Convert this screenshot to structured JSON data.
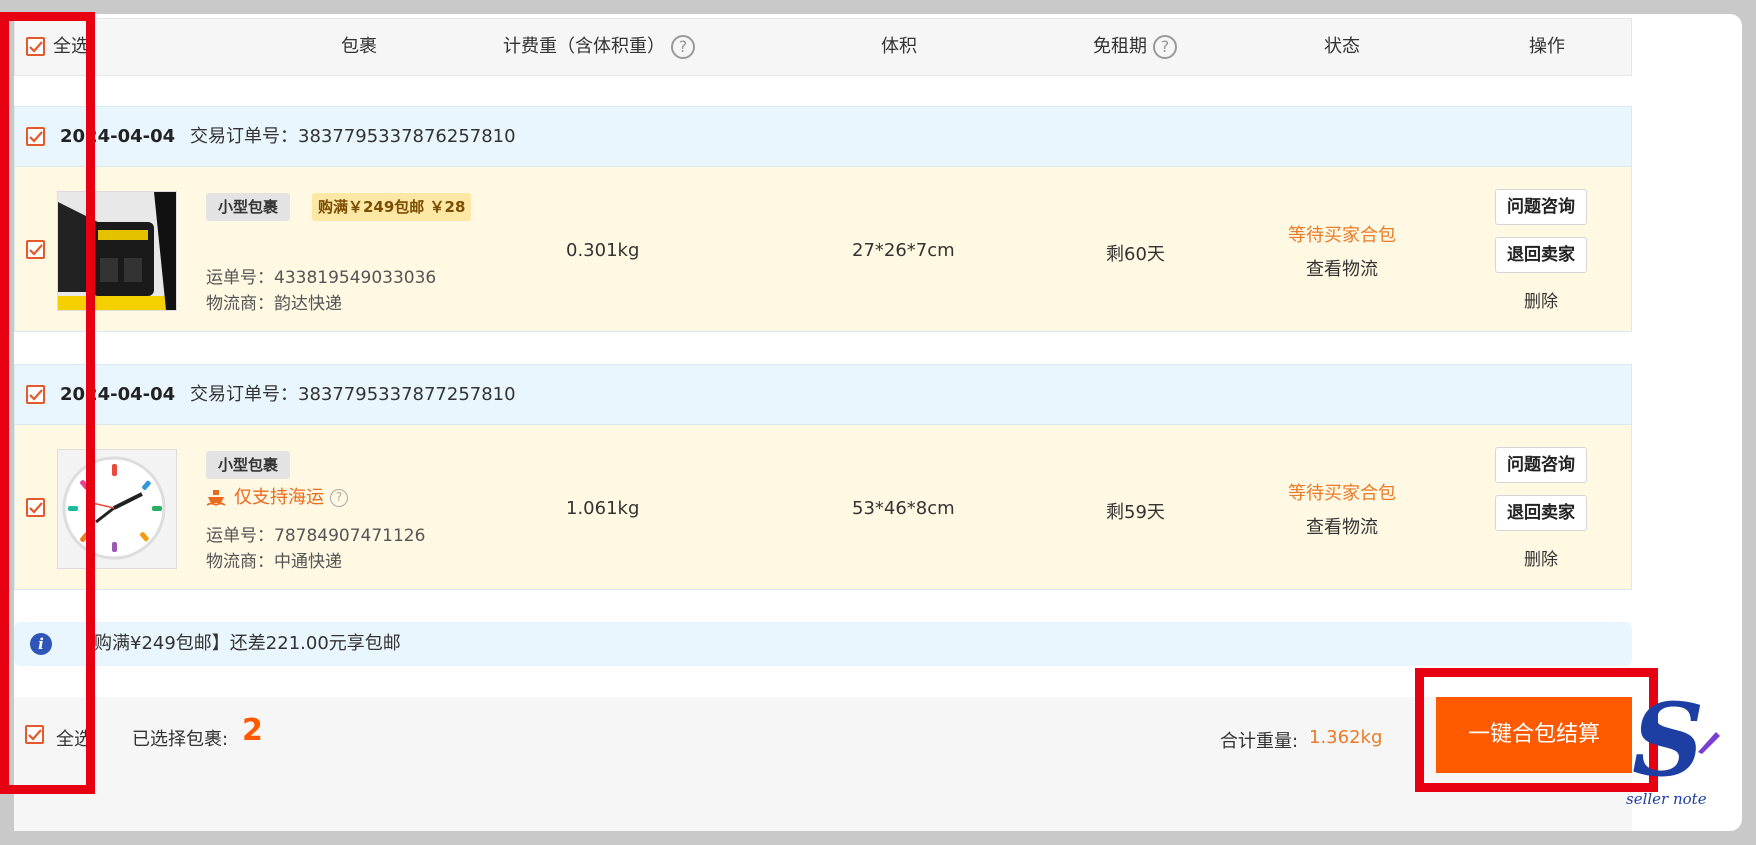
{
  "header": {
    "select_all": "全选",
    "col_package": "包裹",
    "col_weight": "计费重（含体积重）",
    "col_volume": "体积",
    "col_free_period": "免租期",
    "col_status": "状态",
    "col_action": "操作",
    "help_glyph": "?"
  },
  "orders": [
    {
      "date": "2024-04-04",
      "order_label": "交易订单号：3837795337876257810",
      "tag_type": "小型包裹",
      "promo_tag": "购满￥249包邮 ￥28",
      "tracking": "运单号：433819549033036",
      "carrier": "物流商：韵达快递",
      "weight": "0.301kg",
      "volume": "27*26*7cm",
      "free_days": "剩60天",
      "status": "等待买家合包",
      "view_logistics": "查看物流",
      "btn_inquiry": "问题咨询",
      "btn_return": "退回卖家",
      "btn_delete": "删除"
    },
    {
      "date": "2024-04-04",
      "order_label": "交易订单号：3837795337877257810",
      "tag_type": "小型包裹",
      "shipping_note": "仅支持海运",
      "tracking": "运单号：78784907471126",
      "carrier": "物流商：中通快递",
      "weight": "1.061kg",
      "volume": "53*46*8cm",
      "free_days": "剩59天",
      "status": "等待买家合包",
      "view_logistics": "查看物流",
      "btn_inquiry": "问题咨询",
      "btn_return": "退回卖家",
      "btn_delete": "删除"
    }
  ],
  "notice": {
    "icon_glyph": "i",
    "text": "【购满¥249包邮】还差221.00元享包邮"
  },
  "footer": {
    "select_all": "全选",
    "selected_label": "已选择包裹:",
    "selected_count": "2",
    "total_weight_label": "合计重量:",
    "total_weight": "1.362kg",
    "checkout": "一键合包结算"
  },
  "logo": {
    "letter": "S",
    "caption": "seller note"
  },
  "colors": {
    "accent": "#ff5a00",
    "status": "#ea7b28",
    "highlight_box": "#e60012",
    "row_bg": "#fff8e3",
    "order_head_bg": "#e9f6fd"
  }
}
